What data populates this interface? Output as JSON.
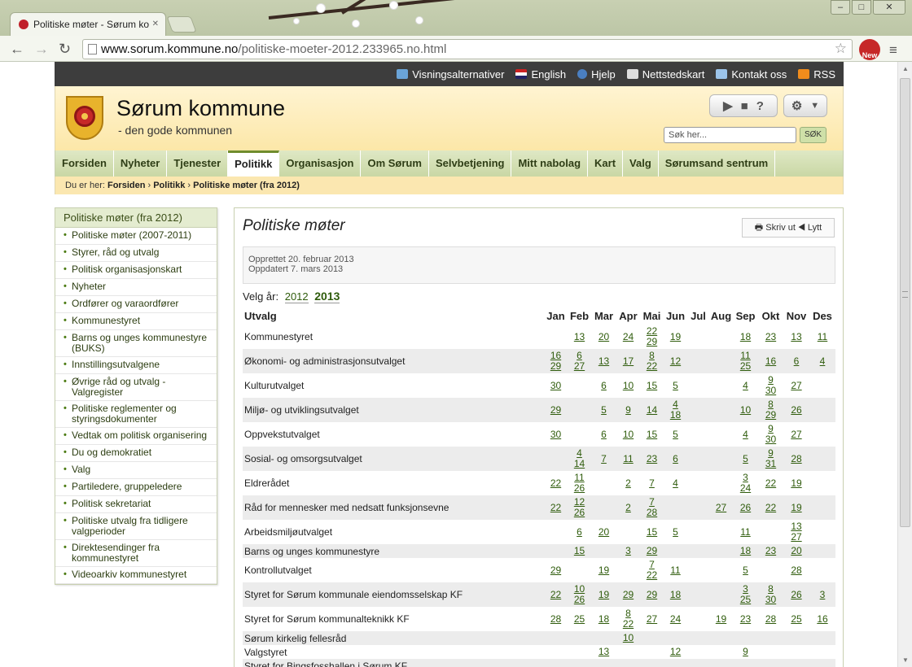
{
  "browser": {
    "tab_title": "Politiske møter - Sørum ko",
    "url_host": "www.sorum.kommune.no",
    "url_path": "/politiske-moeter-2012.233965.no.html",
    "extension_badge": "New"
  },
  "topbar": {
    "items": [
      "Visningsalternativer",
      "English",
      "Hjelp",
      "Nettstedskart",
      "Kontakt oss",
      "RSS"
    ]
  },
  "header": {
    "site_name": "Sørum kommune",
    "tagline": "- den gode kommunen",
    "search_placeholder": "Søk her...",
    "search_button": "SØK"
  },
  "nav": {
    "items": [
      "Forsiden",
      "Nyheter",
      "Tjenester",
      "Politikk",
      "Organisasjon",
      "Om Sørum",
      "Selvbetjening",
      "Mitt nabolag",
      "Kart",
      "Valg",
      "Sørumsand sentrum"
    ],
    "active": "Politikk"
  },
  "breadcrumb": {
    "prefix": "Du er her:",
    "items": [
      "Forsiden",
      "Politikk",
      "Politiske møter (fra 2012)"
    ]
  },
  "sidebar": {
    "header": "Politiske møter (fra 2012)",
    "items": [
      "Politiske møter (2007-2011)",
      "Styrer, råd og utvalg",
      "Politisk organisasjonskart",
      "Nyheter",
      "Ordfører og varaordfører",
      "Kommunestyret",
      "Barns og unges kommunestyre (BUKS)",
      "Innstillingsutvalgene",
      "Øvrige råd og utvalg - Valgregister",
      "Politiske reglementer og styringsdokumenter",
      "Vedtak om politisk organisering",
      "Du og demokratiet",
      "Valg",
      "Partiledere, gruppeledere",
      "Politisk sekretariat",
      "Politiske utvalg fra tidligere valgperioder",
      "Direktesendinger fra kommunestyret",
      "Videoarkiv kommunestyret"
    ]
  },
  "content": {
    "title": "Politiske møter",
    "print": "Skriv ut",
    "listen": "Lytt",
    "created": "Opprettet 20. februar 2013",
    "updated": "Oppdatert 7. mars 2013",
    "year_label": "Velg år:",
    "years": [
      "2012",
      "2013"
    ],
    "selected_year": "2013",
    "table": {
      "unit_header": "Utvalg",
      "months": [
        "Jan",
        "Feb",
        "Mar",
        "Apr",
        "Mai",
        "Jun",
        "Jul",
        "Aug",
        "Sep",
        "Okt",
        "Nov",
        "Des"
      ],
      "rows": [
        {
          "name": "Kommunestyret",
          "cells": [
            [],
            [
              "13"
            ],
            [
              "20"
            ],
            [
              "24"
            ],
            [
              "22",
              "29"
            ],
            [
              "19"
            ],
            [],
            [],
            [
              "18"
            ],
            [
              "23"
            ],
            [
              "13"
            ],
            [
              "11"
            ]
          ]
        },
        {
          "name": "Økonomi- og administrasjonsutvalget",
          "cells": [
            [
              "16",
              "29"
            ],
            [
              "6",
              "27"
            ],
            [
              "13"
            ],
            [
              "17"
            ],
            [
              "8",
              "22"
            ],
            [
              "12"
            ],
            [],
            [],
            [
              "11",
              "25"
            ],
            [
              "16"
            ],
            [
              "6"
            ],
            [
              "4"
            ]
          ]
        },
        {
          "name": "Kulturutvalget",
          "cells": [
            [
              "30"
            ],
            [],
            [
              "6"
            ],
            [
              "10"
            ],
            [
              "15"
            ],
            [
              "5"
            ],
            [],
            [],
            [
              "4"
            ],
            [
              "9",
              "30"
            ],
            [
              "27"
            ],
            []
          ]
        },
        {
          "name": "Miljø- og utviklingsutvalget",
          "cells": [
            [
              "29"
            ],
            [],
            [
              "5"
            ],
            [
              "9"
            ],
            [
              "14"
            ],
            [
              "4",
              "18"
            ],
            [],
            [],
            [
              "10"
            ],
            [
              "8",
              "29"
            ],
            [
              "26"
            ],
            []
          ]
        },
        {
          "name": "Oppvekstutvalget",
          "cells": [
            [
              "30"
            ],
            [],
            [
              "6"
            ],
            [
              "10"
            ],
            [
              "15"
            ],
            [
              "5"
            ],
            [],
            [],
            [
              "4"
            ],
            [
              "9",
              "30"
            ],
            [
              "27"
            ],
            []
          ]
        },
        {
          "name": "Sosial- og omsorgsutvalget",
          "cells": [
            [],
            [
              "4",
              "14"
            ],
            [
              "7"
            ],
            [
              "11"
            ],
            [
              "23"
            ],
            [
              "6"
            ],
            [],
            [],
            [
              "5"
            ],
            [
              "9",
              "31"
            ],
            [
              "28"
            ],
            []
          ]
        },
        {
          "name": "Eldrerådet",
          "cells": [
            [
              "22"
            ],
            [
              "11",
              "26"
            ],
            [],
            [
              "2"
            ],
            [
              "7"
            ],
            [
              "4"
            ],
            [],
            [],
            [
              "3",
              "24"
            ],
            [
              "22"
            ],
            [
              "19"
            ],
            []
          ]
        },
        {
          "name": "Råd for mennesker med nedsatt funksjonsevne",
          "cells": [
            [
              "22"
            ],
            [
              "12",
              "26"
            ],
            [],
            [
              "2"
            ],
            [
              "7",
              "28"
            ],
            [],
            [],
            [
              "27"
            ],
            [
              "26"
            ],
            [
              "22"
            ],
            [
              "19"
            ],
            []
          ]
        },
        {
          "name": "Arbeidsmiljøutvalget",
          "cells": [
            [],
            [
              "6"
            ],
            [
              "20"
            ],
            [],
            [
              "15"
            ],
            [
              "5"
            ],
            [],
            [],
            [
              "11"
            ],
            [],
            [
              "13",
              "27"
            ],
            []
          ]
        },
        {
          "name": "Barns og unges kommunestyre",
          "cells": [
            [],
            [
              "15"
            ],
            [],
            [
              "3"
            ],
            [
              "29"
            ],
            [],
            [],
            [],
            [
              "18"
            ],
            [
              "23"
            ],
            [
              "20"
            ],
            []
          ]
        },
        {
          "name": "Kontrollutvalget",
          "cells": [
            [
              "29"
            ],
            [],
            [
              "19"
            ],
            [],
            [
              "7",
              "22"
            ],
            [
              "11"
            ],
            [],
            [],
            [
              "5"
            ],
            [],
            [
              "28"
            ],
            []
          ]
        },
        {
          "name": "Styret for Sørum kommunale eiendomsselskap KF",
          "cells": [
            [
              "22"
            ],
            [
              "10",
              "26"
            ],
            [
              "19"
            ],
            [
              "29"
            ],
            [
              "29"
            ],
            [
              "18"
            ],
            [],
            [],
            [
              "3",
              "25"
            ],
            [
              "8",
              "30"
            ],
            [
              "26"
            ],
            [
              "3"
            ]
          ]
        },
        {
          "name": "Styret for Sørum kommunalteknikk KF",
          "cells": [
            [
              "28"
            ],
            [
              "25"
            ],
            [
              "18"
            ],
            [
              "8",
              "22"
            ],
            [
              "27"
            ],
            [
              "24"
            ],
            [],
            [
              "19"
            ],
            [
              "23"
            ],
            [
              "28"
            ],
            [
              "25"
            ],
            [
              "16"
            ]
          ]
        },
        {
          "name": "Sørum kirkelig fellesråd",
          "cells": [
            [],
            [],
            [],
            [
              "10"
            ],
            [],
            [],
            [],
            [],
            [],
            [],
            [],
            []
          ]
        },
        {
          "name": "Valgstyret",
          "cells": [
            [],
            [],
            [
              "13"
            ],
            [],
            [],
            [
              "12"
            ],
            [],
            [],
            [
              "9"
            ],
            [],
            [],
            []
          ]
        },
        {
          "name": "Styret for Bingsfosshallen i Sørum KF",
          "cells": [
            [],
            [],
            [],
            [],
            [],
            [],
            [],
            [],
            [],
            [],
            [],
            []
          ]
        }
      ]
    }
  },
  "colors": {
    "link": "#2f5c0c",
    "nav_bg": "#dfe8c5",
    "topbar_bg": "#3d3d3d",
    "header_bg": "#fff4d2"
  }
}
